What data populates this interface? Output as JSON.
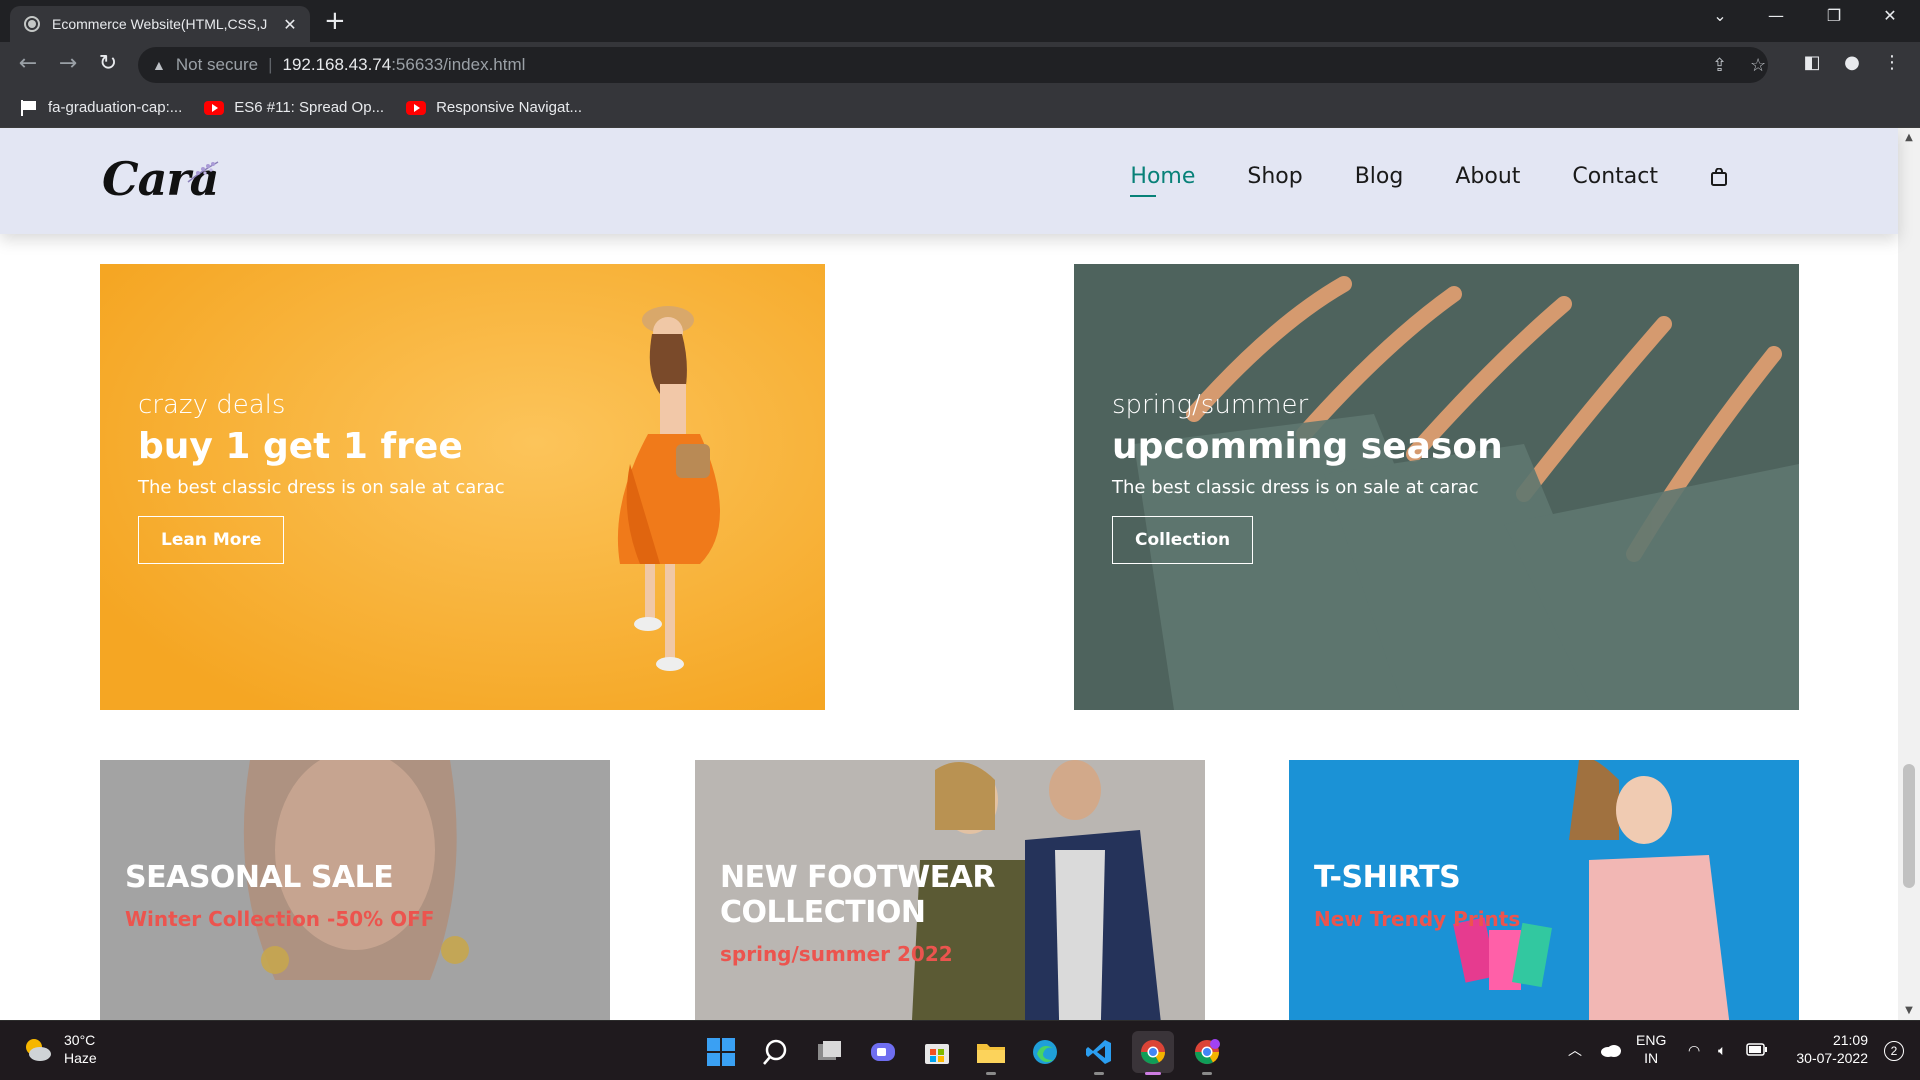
{
  "browser": {
    "tab_title": "Ecommerce Website(HTML,CSS,J",
    "url_warning": "Not secure",
    "url_host": "192.168.43.74",
    "url_path": ":56633/index.html",
    "bookmarks": [
      {
        "label": "fa-graduation-cap:..."
      },
      {
        "label": "ES6 #11: Spread Op..."
      },
      {
        "label": "Responsive Navigat..."
      }
    ]
  },
  "site": {
    "logo": "Cara",
    "nav": [
      {
        "label": "Home"
      },
      {
        "label": "Shop"
      },
      {
        "label": "Blog"
      },
      {
        "label": "About"
      },
      {
        "label": "Contact"
      }
    ]
  },
  "banners": [
    {
      "small": "crazy deals",
      "big": "buy 1 get 1 free",
      "desc": "The best classic dress is on sale at carac",
      "button": "Lean More",
      "bg": "#f9b233"
    },
    {
      "small": "spring/summer",
      "big": "upcomming season",
      "desc": "The best classic dress is on sale at carac",
      "button": "Collection",
      "bg": "#4f6660"
    }
  ],
  "small_banners": [
    {
      "title": "SEASONAL SALE",
      "subtitle": "Winter Collection -50% OFF",
      "bg": "#9d9d9d"
    },
    {
      "title": "NEW FOOTWEAR COLLECTION",
      "subtitle": "spring/summer 2022",
      "bg": "#b5b2b0"
    },
    {
      "title": "T-SHIRTS",
      "subtitle": "New Trendy Prints",
      "bg": "#1a8fd4"
    }
  ],
  "taskbar": {
    "weather_temp": "30°C",
    "weather_desc": "Haze",
    "lang_top": "ENG",
    "lang_bottom": "IN",
    "time": "21:09",
    "date": "30-07-2022",
    "notifications": "2"
  },
  "colors": {
    "accent": "#088178",
    "header_bg": "#e3e6f3",
    "sale_red": "#ec544e"
  }
}
